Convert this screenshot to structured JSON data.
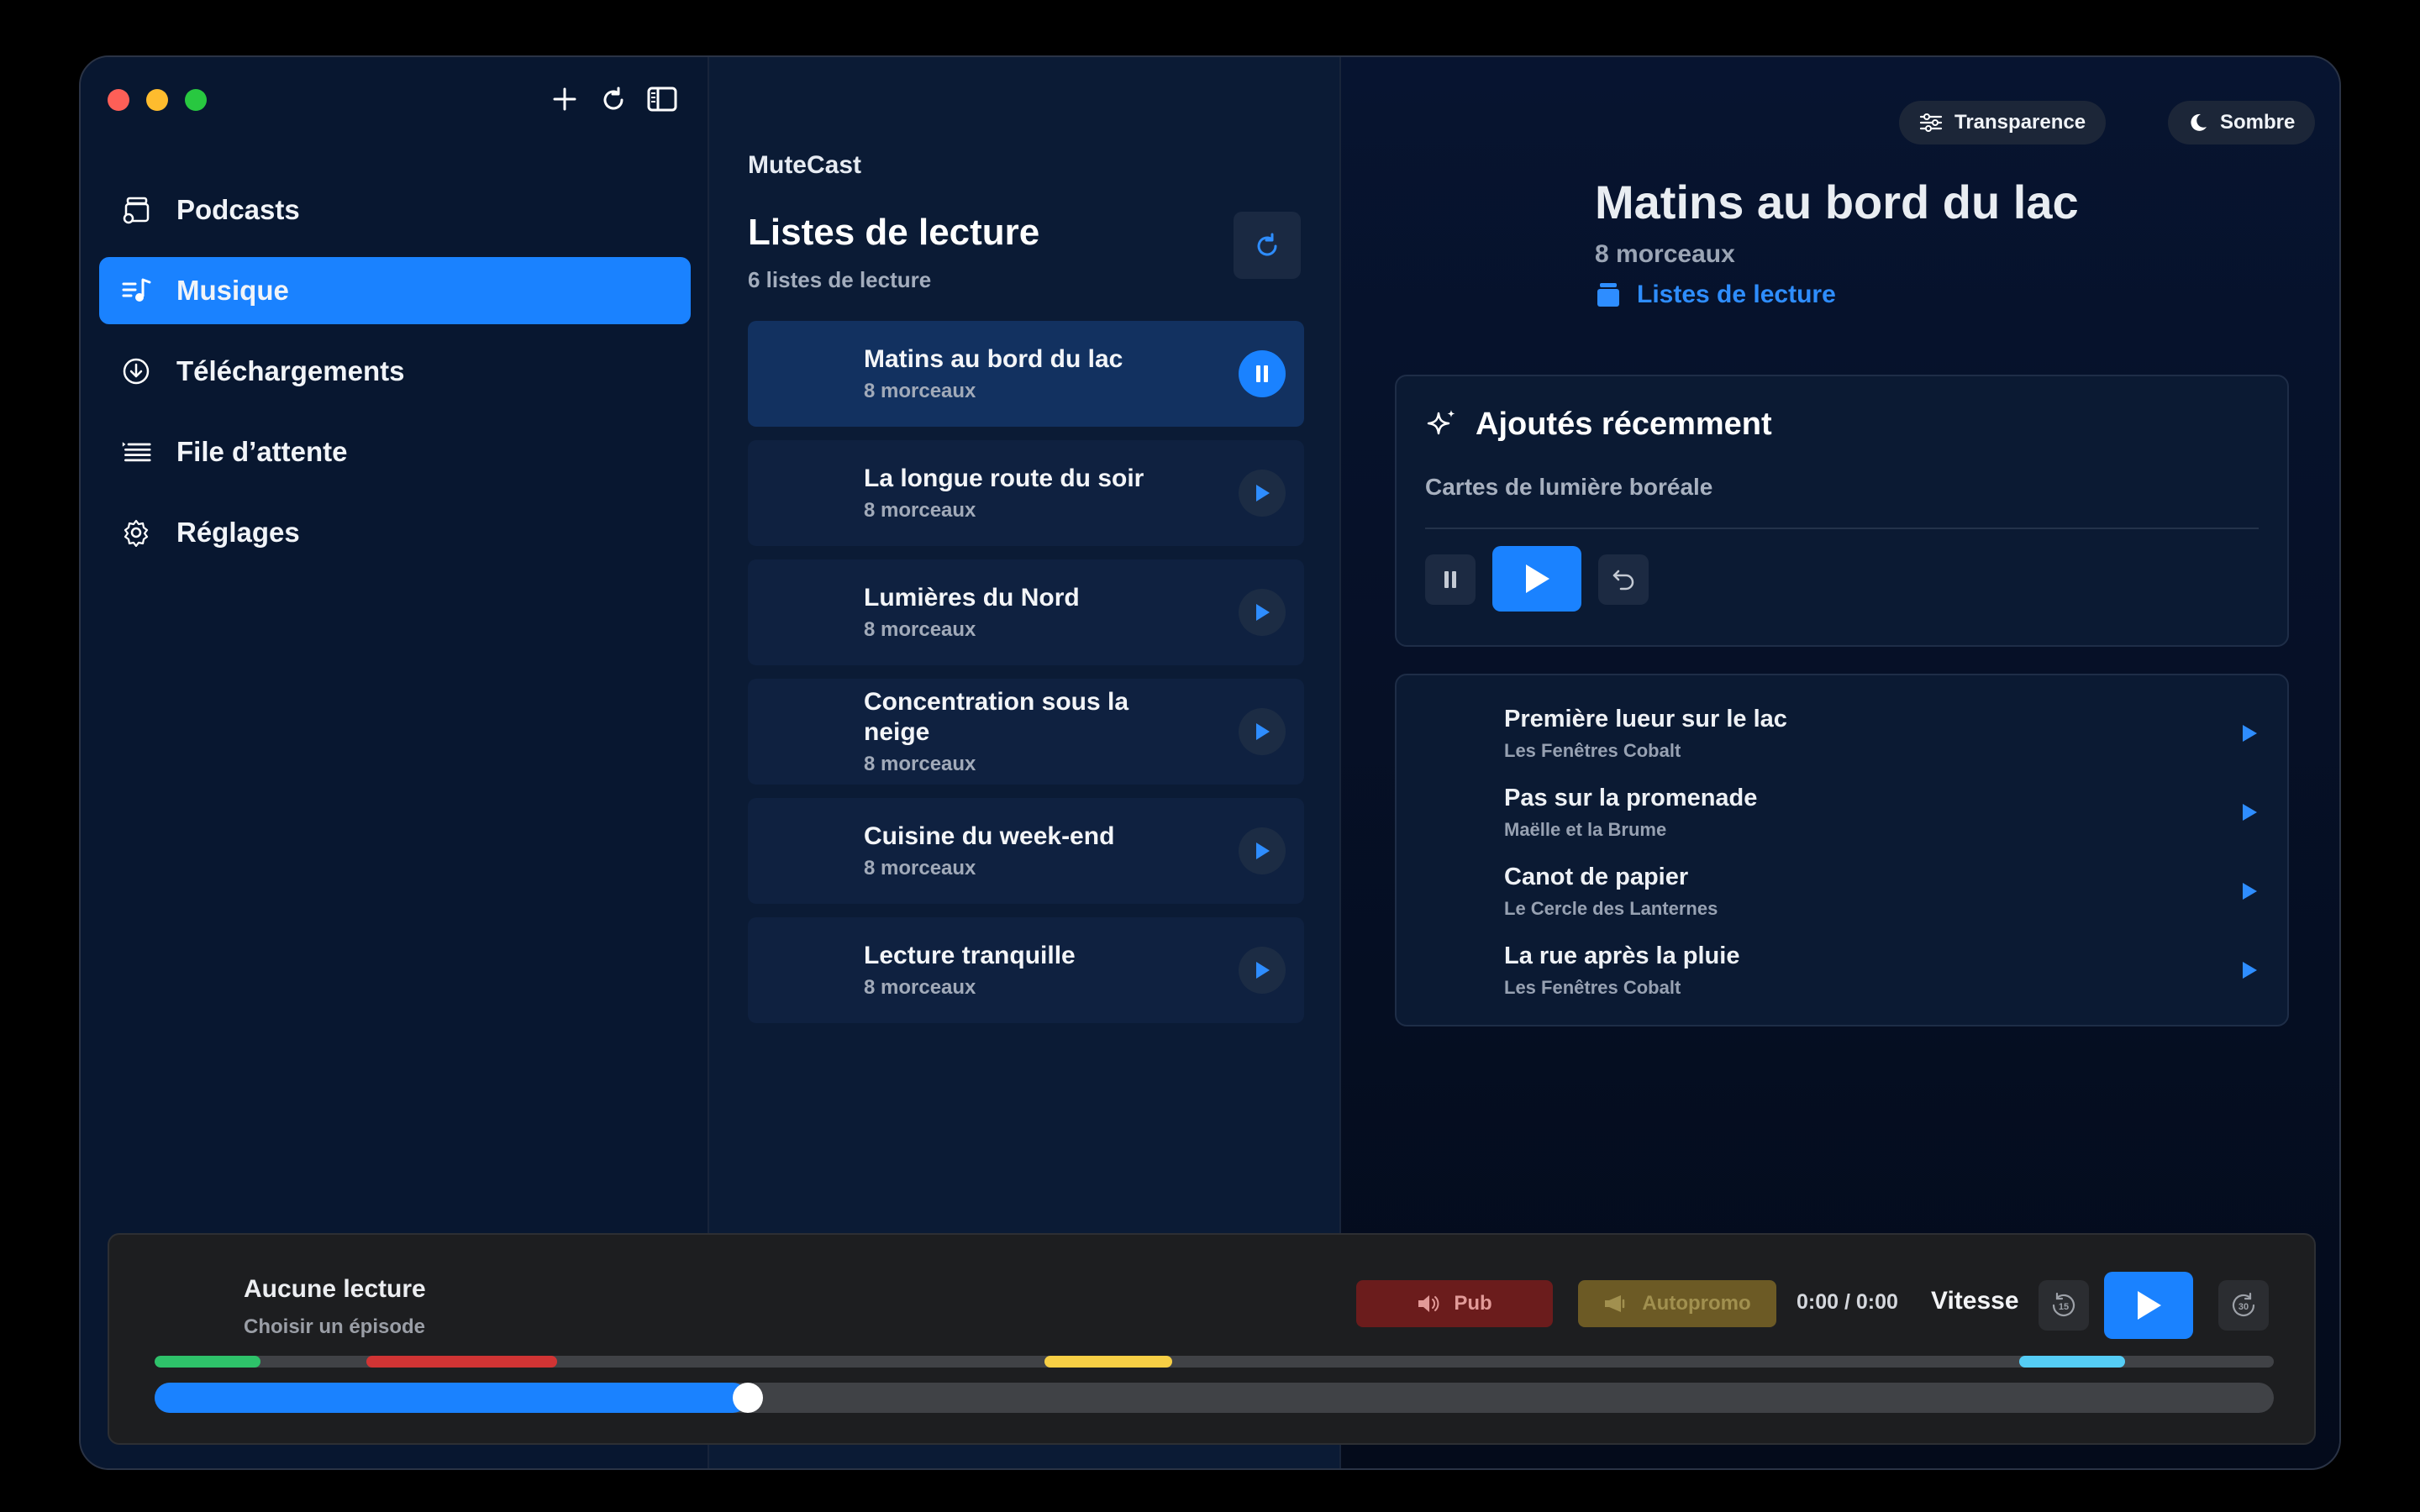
{
  "app": {
    "name": "MuteCast"
  },
  "colors": {
    "accent": "#1a82ff",
    "pub": "#6b1c1c",
    "autopromo": "#6c5a25"
  },
  "toolbar": {
    "icons": [
      "plus-icon",
      "refresh-icon",
      "sidebar-toggle-icon"
    ]
  },
  "sidebar": {
    "items": [
      {
        "label": "Podcasts",
        "icon": "podcasts-icon",
        "active": false
      },
      {
        "label": "Musique",
        "icon": "music-icon",
        "active": true
      },
      {
        "label": "Téléchargements",
        "icon": "download-icon",
        "active": false
      },
      {
        "label": "File d’attente",
        "icon": "queue-icon",
        "active": false
      },
      {
        "label": "Réglages",
        "icon": "gear-icon",
        "active": false
      }
    ]
  },
  "playlists": {
    "title": "Listes de lecture",
    "subtitle": "6 listes de lecture",
    "items": [
      {
        "name": "Matins au bord du lac",
        "count": "8 morceaux",
        "state": "playing"
      },
      {
        "name": "La longue route du soir",
        "count": "8 morceaux",
        "state": "idle"
      },
      {
        "name": "Lumières du Nord",
        "count": "8 morceaux",
        "state": "idle"
      },
      {
        "name": "Concentration sous la neige",
        "count": "8 morceaux",
        "state": "idle"
      },
      {
        "name": "Cuisine du week-end",
        "count": "8 morceaux",
        "state": "idle"
      },
      {
        "name": "Lecture tranquille",
        "count": "8 morceaux",
        "state": "idle"
      }
    ]
  },
  "detail": {
    "pills": {
      "transparency": "Transparence",
      "theme": "Sombre"
    },
    "title": "Matins au bord du lac",
    "subtitle": "8 morceaux",
    "link": "Listes de lecture",
    "recent": {
      "title": "Ajoutés récemment",
      "subtitle": "Cartes de lumière boréale"
    },
    "tracks": [
      {
        "title": "Première lueur sur le lac",
        "artist": "Les Fenêtres Cobalt"
      },
      {
        "title": "Pas sur la promenade",
        "artist": "Maëlle et la Brume"
      },
      {
        "title": "Canot de papier",
        "artist": "Le Cercle des Lanternes"
      },
      {
        "title": "La rue après la pluie",
        "artist": "Les Fenêtres Cobalt"
      }
    ]
  },
  "player": {
    "title": "Aucune lecture",
    "subtitle": "Choisir un épisode",
    "pub_label": "Pub",
    "autopromo_label": "Autopromo",
    "time": "0:00 / 0:00",
    "speed_label": "Vitesse",
    "skip_back": "15",
    "skip_forward": "30",
    "progress_fraction": 0.28,
    "segments": [
      {
        "kind": "green",
        "color": "#2ec26a",
        "start": 0.0,
        "end": 0.05
      },
      {
        "kind": "red",
        "color": "#d13434",
        "start": 0.1,
        "end": 0.19
      },
      {
        "kind": "yellow",
        "color": "#f7cf45",
        "start": 0.42,
        "end": 0.48
      },
      {
        "kind": "cyan",
        "color": "#55cdf5",
        "start": 0.88,
        "end": 0.93
      }
    ]
  }
}
